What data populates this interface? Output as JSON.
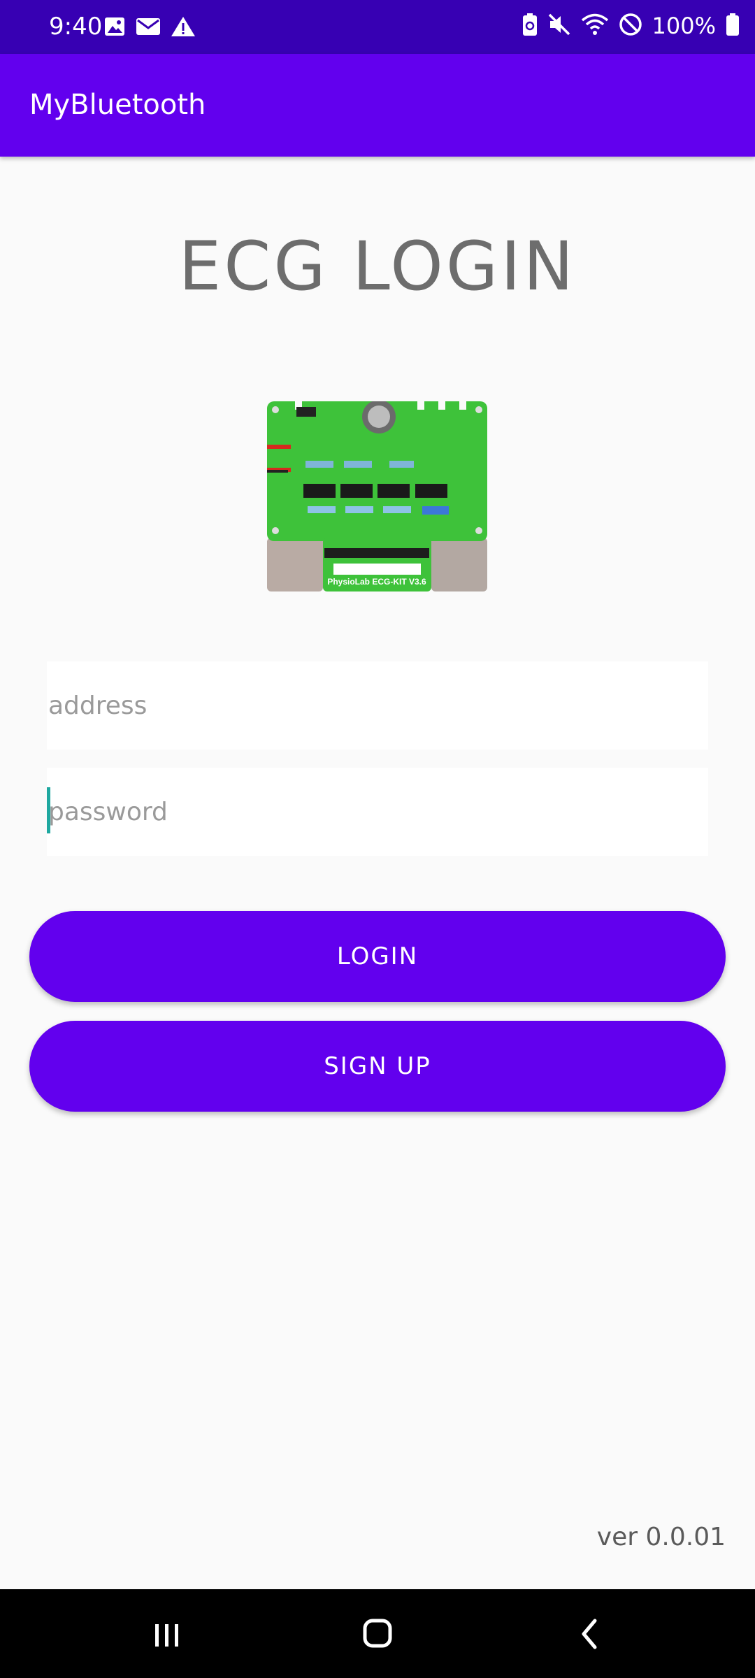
{
  "status_bar": {
    "time": "9:40",
    "battery": "100%",
    "left_icons": [
      "image-icon",
      "mail-icon",
      "warning-icon"
    ],
    "right_icons": [
      "battery-saver-icon",
      "mute-icon",
      "wifi-icon",
      "do-not-disturb-icon",
      "battery-icon"
    ]
  },
  "app_bar": {
    "title": "MyBluetooth"
  },
  "page": {
    "title": "ECG LOGIN"
  },
  "device_image": {
    "label": "PhysioLab ECG-KIT V3.6"
  },
  "form": {
    "address_placeholder": "address",
    "address_value": "",
    "password_placeholder": "password",
    "password_value": ""
  },
  "buttons": {
    "login": "LOGIN",
    "signup": "SIGN UP"
  },
  "footer": {
    "version": "ver 0.0.01"
  },
  "nav_bar": {
    "items": [
      "recent-apps-icon",
      "home-icon",
      "back-icon"
    ]
  },
  "colors": {
    "status_bar": "#3700b3",
    "app_bar": "#6200ee",
    "button": "#6200ee",
    "background": "#fafafa",
    "cursor": "#1ea8a0"
  }
}
